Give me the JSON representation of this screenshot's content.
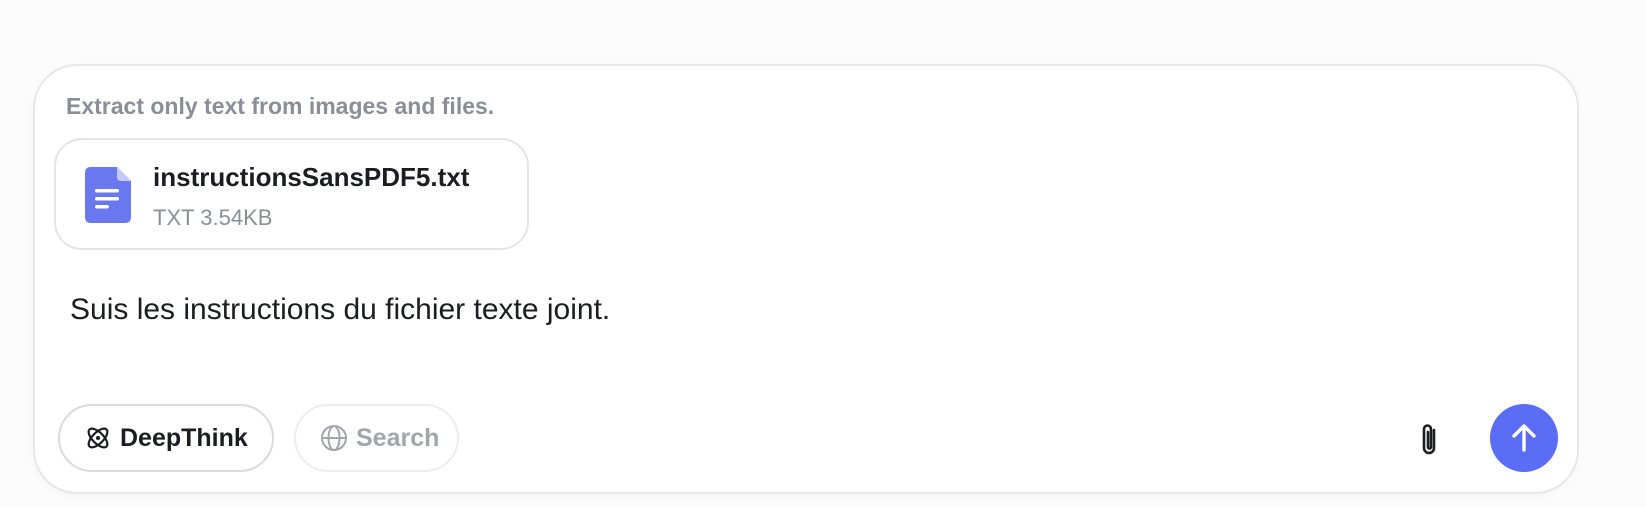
{
  "composer": {
    "hint": "Extract only text from images and files."
  },
  "attachment": {
    "file_name": "instructionsSansPDF5.txt",
    "file_meta": "TXT 3.54KB",
    "icon": "document-icon"
  },
  "message": {
    "text": "Suis les instructions du fichier texte joint."
  },
  "toolbar": {
    "deepthink_label": "DeepThink",
    "deepthink_icon": "atom-icon",
    "search_label": "Search",
    "search_icon": "globe-icon",
    "attach_icon": "paperclip-icon",
    "send_icon": "arrow-up-icon"
  },
  "colors": {
    "accent": "#5b6cf5",
    "file_icon": "#6a78f0",
    "muted_text": "#8b8e96",
    "border": "#e6e7ea"
  }
}
